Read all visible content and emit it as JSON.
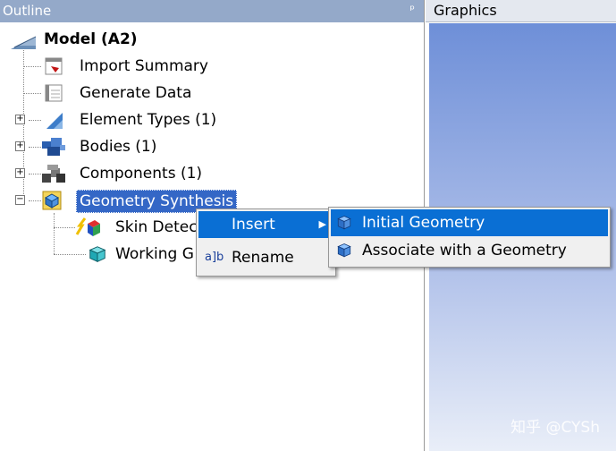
{
  "outline": {
    "title": "Outline",
    "pin_glyph": "ᵖ",
    "tree": {
      "model": "Model (A2)",
      "import_summary": "Import Summary",
      "generate_data": "Generate Data",
      "element_types": "Element Types (1)",
      "bodies": "Bodies (1)",
      "components": "Components (1)",
      "geometry_synthesis": "Geometry Synthesis",
      "skin_detection": "Skin Detec",
      "working_geometry": "Working G"
    }
  },
  "graphics": {
    "title": "Graphics",
    "watermark": "知乎 @CYSh"
  },
  "context_menu": {
    "insert": "Insert",
    "rename": "Rename",
    "rename_icon_glyph": "a]b",
    "submenu_arrow": "▶"
  },
  "submenu": {
    "initial_geometry": "Initial Geometry",
    "associate_geometry": "Associate with a Geometry"
  },
  "tree_expanders": {
    "plus": "+",
    "minus": "−"
  },
  "colors": {
    "selection": "#0a6fd4",
    "header": "#94a9c9",
    "graphics_top": "#6e8fd8"
  }
}
